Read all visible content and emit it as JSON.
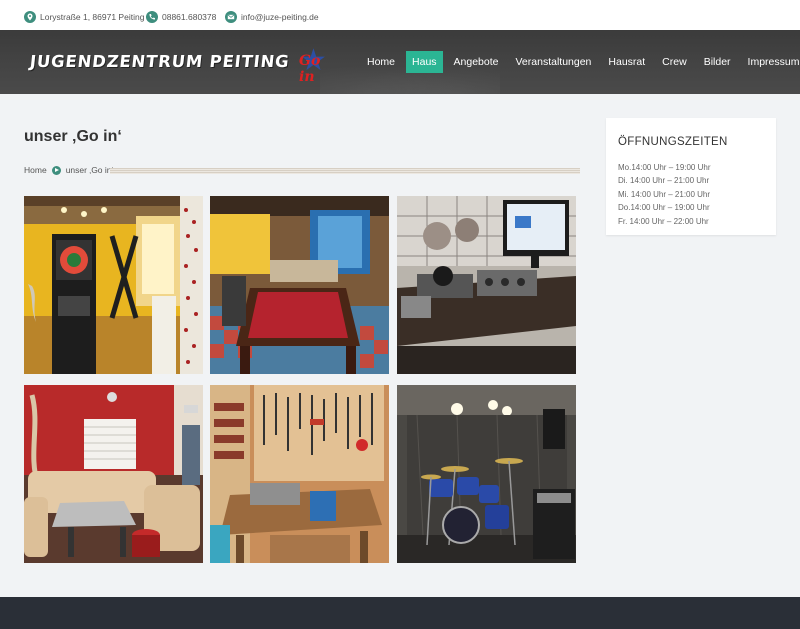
{
  "contact": {
    "address": "Lorystraße 1, 86971 Peiting",
    "phone": "08861.680378",
    "email": "info@juze-peiting.de",
    "icons": [
      "location-pin-icon",
      "phone-icon",
      "envelope-icon"
    ]
  },
  "header": {
    "brand": "JUGENDZENTRUM PEITING",
    "logo_text": "Go in"
  },
  "nav": [
    {
      "label": "Home",
      "active": false
    },
    {
      "label": "Haus",
      "active": true
    },
    {
      "label": "Angebote",
      "active": false
    },
    {
      "label": "Veranstaltungen",
      "active": false
    },
    {
      "label": "Hausrat",
      "active": false
    },
    {
      "label": "Crew",
      "active": false
    },
    {
      "label": "Bilder",
      "active": false
    },
    {
      "label": "Impressum",
      "active": false
    }
  ],
  "page": {
    "title": "unser ‚Go in‘",
    "breadcrumb": [
      "Home",
      "unser ‚Go in‘"
    ]
  },
  "sidebar": {
    "title": "ÖFFNUNGSZEITEN",
    "hours": [
      "Mo.14:00 Uhr – 19:00 Uhr",
      "Di.  14:00 Uhr – 21:00 Uhr",
      "Mi.  14:00 Uhr – 21:00 Uhr",
      "Do.14:00 Uhr – 19:00 Uhr",
      "Fr.  14:00 Uhr – 22:00 Uhr"
    ]
  },
  "colors": {
    "accent": "#2bb594",
    "icon_teal": "#3e8e7e",
    "header_bg": "#444444",
    "footer_bg": "#2a2f37"
  }
}
